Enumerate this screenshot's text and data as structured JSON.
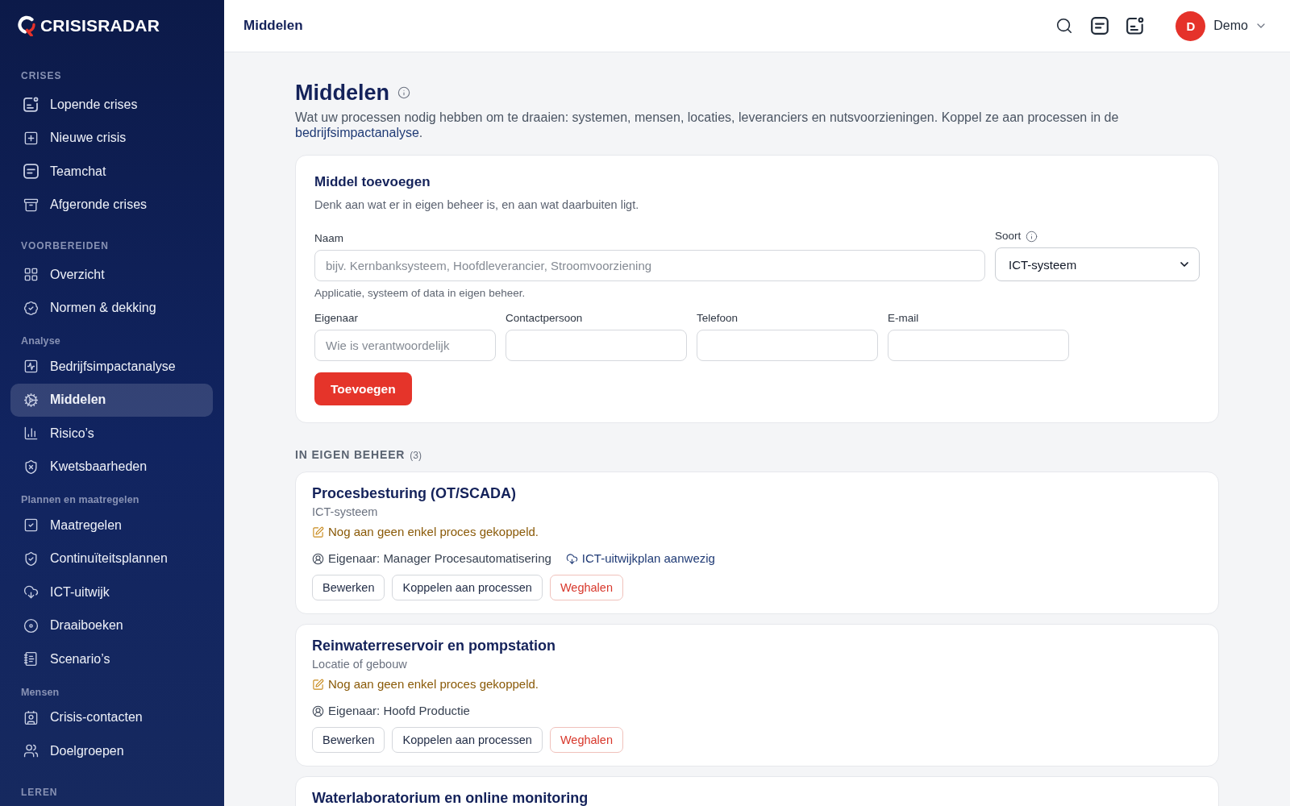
{
  "sidebar": {
    "logo": "CRISISRADAR",
    "groups": [
      {
        "title": "CRISES",
        "kind": "section",
        "items": [
          {
            "label": "Lopende crises",
            "selected": false
          },
          {
            "label": "Nieuwe crisis",
            "selected": false
          },
          {
            "label": "Teamchat",
            "selected": false
          },
          {
            "label": "Afgeronde crises",
            "selected": false
          }
        ]
      },
      {
        "title": "VOORBEREIDEN",
        "kind": "section",
        "items": [
          {
            "label": "Overzicht",
            "selected": false
          },
          {
            "label": "Normen & dekking",
            "selected": false
          }
        ]
      },
      {
        "title": "Analyse",
        "kind": "subsection",
        "items": [
          {
            "label": "Bedrijfsimpactanalyse",
            "selected": false
          },
          {
            "label": "Middelen",
            "selected": true
          },
          {
            "label": "Risico’s",
            "selected": false
          },
          {
            "label": "Kwetsbaarheden",
            "selected": false
          }
        ]
      },
      {
        "title": "Plannen en maatregelen",
        "kind": "subsection",
        "items": [
          {
            "label": "Maatregelen",
            "selected": false
          },
          {
            "label": "Continuïteitsplannen",
            "selected": false
          },
          {
            "label": "ICT-uitwijk",
            "selected": false
          },
          {
            "label": "Draaiboeken",
            "selected": false
          },
          {
            "label": "Scenario’s",
            "selected": false
          }
        ]
      },
      {
        "title": "Mensen",
        "kind": "subsection",
        "items": [
          {
            "label": "Crisis-contacten",
            "selected": false
          },
          {
            "label": "Doelgroepen",
            "selected": false
          }
        ]
      },
      {
        "title": "LEREN",
        "kind": "section"
      }
    ]
  },
  "header": {
    "title": "Middelen",
    "user": {
      "initial": "D",
      "name": "Demo"
    }
  },
  "page": {
    "title": "Middelen",
    "description": "Wat uw processen nodig hebben om te draaien: systemen, mensen, locaties, leveranciers en nutsvoorzieningen. Koppel ze aan processen in de",
    "link": "bedrijfsimpactanalyse",
    "description_end": "."
  },
  "form": {
    "title": "Middel toevoegen",
    "subtitle": "Denk aan wat er in eigen beheer is, en aan wat daarbuiten ligt.",
    "name_field": {
      "label": "Naam",
      "placeholder": "bijv. Kernbanksysteem, Hoofdleverancier, Stroomvoorziening",
      "hint": "Applicatie, systeem of data in eigen beheer."
    },
    "type_field": {
      "label": "Soort",
      "value": "ICT-systeem"
    },
    "contact_fields": [
      {
        "label": "Eigenaar",
        "placeholder": "Wie is verantwoordelijk"
      },
      {
        "label": "Contactpersoon"
      },
      {
        "label": "Telefoon"
      },
      {
        "label": "E-mail"
      }
    ],
    "submit": "Toevoegen"
  },
  "sections": [
    {
      "title": "IN EIGEN BEHEER",
      "count": "(3)",
      "resources": [
        {
          "name": "Procesbesturing (OT/SCADA)",
          "type": "ICT-systeem",
          "warning": "Nog aan geen enkel proces gekoppeld.",
          "meta": [
            {
              "kind": "owner",
              "text": "Eigenaar: Manager Procesautomatisering"
            },
            {
              "kind": "fallback",
              "text": "ICT-uitwijkplan aanwezig"
            }
          ],
          "actions": [
            {
              "label": "Bewerken",
              "kind": "default"
            },
            {
              "label": "Koppelen aan processen",
              "kind": "default"
            },
            {
              "label": "Weghalen",
              "kind": "danger"
            }
          ]
        },
        {
          "name": "Reinwaterreservoir en pompstation",
          "type": "Locatie of gebouw",
          "warning": "Nog aan geen enkel proces gekoppeld.",
          "meta": [
            {
              "kind": "owner",
              "text": "Eigenaar: Hoofd Productie"
            }
          ],
          "actions": [
            {
              "label": "Bewerken",
              "kind": "default"
            },
            {
              "label": "Koppelen aan processen",
              "kind": "default"
            },
            {
              "label": "Weghalen",
              "kind": "danger"
            }
          ]
        },
        {
          "name": "Waterlaboratorium en online monitoring"
        }
      ]
    }
  ]
}
